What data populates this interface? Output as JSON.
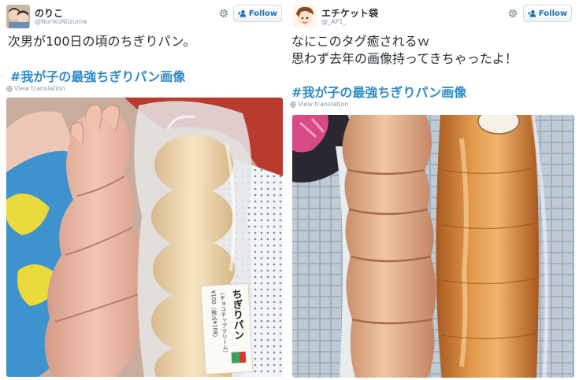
{
  "tweets": [
    {
      "display_name": "のりこ",
      "handle": "@NorikoNiizuma",
      "follow_label": "Follow",
      "text_lines": [
        "次男が100日の頃のちぎりパン。"
      ],
      "hashtag": "#我が子の最強ちぎりパン画像",
      "view_translation": "View translation",
      "bread_label_title": "ちぎりパン",
      "bread_label_sub": "（チョコチップクリーム）",
      "bread_label_price": "¥100（税込¥108）"
    },
    {
      "display_name": "エチケット袋",
      "handle": "@_AP1_",
      "follow_label": "Follow",
      "text_lines": [
        "なにこのタグ癒されるｗ",
        "思わず去年の画像持ってきちゃったよ！"
      ],
      "hashtag": "#我が子の最強ちぎりパン画像",
      "view_translation": "View translation"
    }
  ],
  "colors": {
    "link": "#2f8bc6",
    "follow_text": "#1f6fb0",
    "meta": "#8899a6",
    "body_text": "#292f33"
  },
  "icons": {
    "settings": "gear-icon",
    "follow": "add-person-icon",
    "translate": "globe-icon"
  }
}
